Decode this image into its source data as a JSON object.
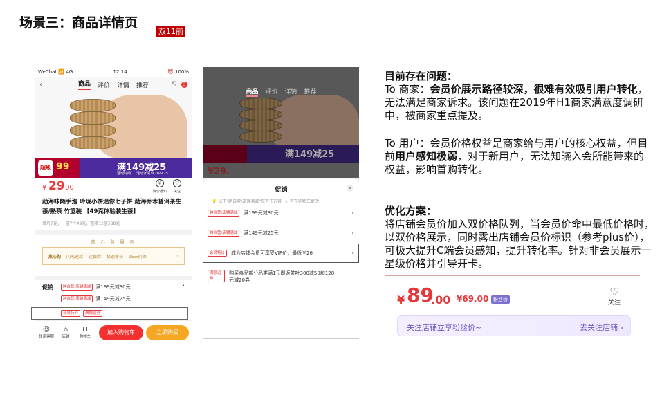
{
  "slide": {
    "title": "场景三：商品详情页",
    "tag": "双11前"
  },
  "phone1": {
    "status": {
      "carrier": "WeChat 📶 4G",
      "time": "12:14",
      "battery": "⏰ 100%"
    },
    "nav": {
      "tabs": [
        "商品",
        "评价",
        "详情",
        "推荐"
      ],
      "badge": "3"
    },
    "banner": {
      "badge": "超级品牌",
      "big": "99",
      "title": "满149减25",
      "sub": "活动时间 … 活动详情 9.20-9.25"
    },
    "price": {
      "currency": "¥",
      "integer": "29",
      "decimal": ".00",
      "notice_label": "降价通知",
      "follow_label": "关注"
    },
    "name": "勐海味随手泡 玲珑小饼迷你七子饼 勐海乔木普洱茶生茶/熟茶 竹篮装 【49克体验装生茶】",
    "meta": "单片7克，一篮7片49克，整箱12篮588克",
    "service": {
      "header": "放 心 购 服 务",
      "lead": "放心购",
      "items": [
        "闪电退款",
        "运费险",
        "极速审核",
        "15天价保"
      ]
    },
    "promo": {
      "label": "促销",
      "rows": [
        {
          "tag": "跨自营/店铺满减",
          "text": "满199元减30元"
        },
        {
          "tag": "跨自营/店铺满减",
          "text": "满149元减25元"
        },
        {
          "tag": "会员特价",
          "tag2": "满赠送券"
        }
      ]
    },
    "bottom": {
      "service": "联系客服",
      "shop": "店铺",
      "cart": "购物车",
      "add_cart": "加入购物车",
      "buy": "立即购买"
    }
  },
  "phone2": {
    "nav": [
      "商品",
      "评价",
      "详情",
      "推荐"
    ],
    "banner_title": "满149减25",
    "price": "¥29.",
    "sheet": {
      "title": "促销",
      "close": "×",
      "note": "以下\"跨自营/店铺满减\"仅可任选其一，可在购物车更改",
      "rows": [
        {
          "tag": "跨自营/店铺满减",
          "text": "满199元减30元"
        },
        {
          "tag": "跨自营/店铺满减",
          "text": "满149元减25元"
        },
        {
          "tag": "会员特价",
          "text": "成为店铺会员可享受VIP价，最低￥26"
        },
        {
          "tag": "满额返券",
          "text": "购买食品部分品类满1元即返茶叶300减50和128元减20券"
        }
      ]
    }
  },
  "text": {
    "problem_title": "目前存在问题：",
    "merchant_prefix": "To 商家：",
    "merchant_bold": "会员价展示路径较深，很难有效吸引用户转化",
    "merchant_rest": "，无法满足商家诉求。该问题在2019年H1商家满意度调研中，被商家重点提及。",
    "user_prefix": "To 用户：会员价格权益是商家给与用户的核心权益，但目前",
    "user_bold": "用户感知极弱",
    "user_rest": "，对于新用户，无法知晓入会所能带来的权益，影响首购转化。",
    "solution_title": "优化方案：",
    "solution_body": "将店铺会员价加入双价格队列，当会员价命中最低价格时，以双价格展示，同时露出店铺会员价标识（参考plus价），可极大提升C端会员感知，提升转化率。针对非会员展示一星级价格并引导开卡。"
  },
  "optimized": {
    "currency": "¥",
    "integer": "89",
    "decimal": ".00",
    "vip_price": "¥69.00",
    "fan_tag": "粉丝价",
    "follow": "关注",
    "bar_left": "关注店铺立享粉丝价~",
    "bar_right": "去关注店铺 ›"
  },
  "colors": {
    "accent": "#e4393c",
    "purple": "#7b6fd0",
    "tag_red": "#c00000"
  }
}
